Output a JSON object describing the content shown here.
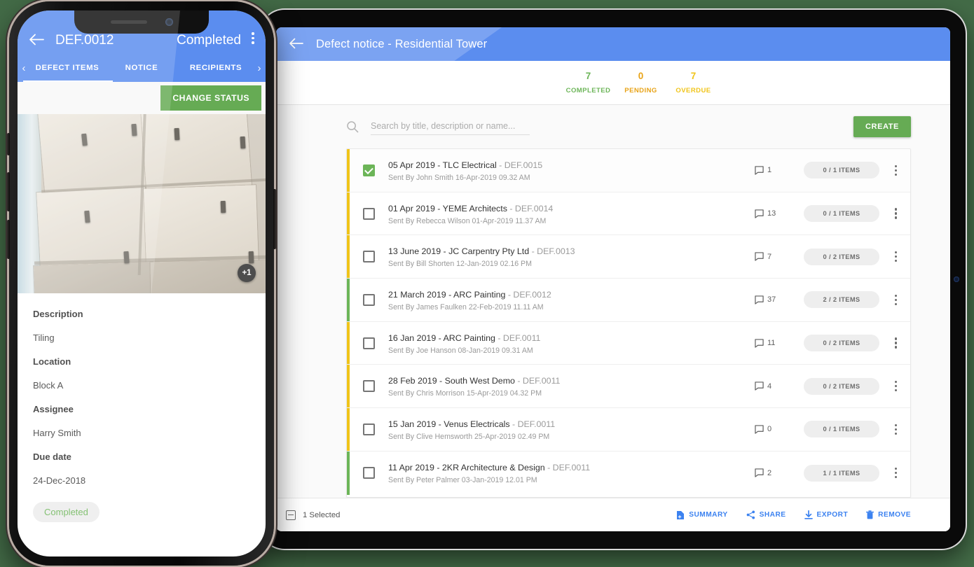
{
  "background_color": "#436b47",
  "tablet": {
    "appbar": {
      "back_icon": "arrow-left-icon",
      "title": "Defect notice - Residential Tower",
      "color": "#5b8def"
    },
    "stats": [
      {
        "num": "7",
        "label": "COMPLETED",
        "color": "#6cb558"
      },
      {
        "num": "0",
        "label": "PENDING",
        "color": "#e8a317"
      },
      {
        "num": "7",
        "label": "OVERDUE",
        "color": "#f0c419"
      }
    ],
    "search": {
      "icon": "search-icon",
      "placeholder": "Search by title, description or name...",
      "value": ""
    },
    "create_button": {
      "label": "CREATE",
      "color": "#66ab54"
    },
    "rows": [
      {
        "title": "05 Apr 2019 - TLC Electrical",
        "ref": " - DEF.0015",
        "sub": "Sent By John Smith 16-Apr-2019 09.32 AM",
        "comments": "1",
        "items": "0 / 1 ITEMS",
        "bar_color": "#f0c419",
        "checked": true
      },
      {
        "title": "01 Apr 2019 - YEME Architects",
        "ref": " - DEF.0014",
        "sub": "Sent By Rebecca Wilson 01-Apr-2019 11.37 AM",
        "comments": "13",
        "items": "0 / 1 ITEMS",
        "bar_color": "#f0c419",
        "checked": false
      },
      {
        "title": "13 June 2019 - JC Carpentry Pty Ltd",
        "ref": " - DEF.0013",
        "sub": "Sent By Bill Shorten 12-Jan-2019 02.16 PM",
        "comments": "7",
        "items": "0 / 2 ITEMS",
        "bar_color": "#f0c419",
        "checked": false
      },
      {
        "title": "21 March 2019 - ARC Painting",
        "ref": " - DEF.0012",
        "sub": "Sent By James Faulken 22-Feb-2019 11.11 AM",
        "comments": "37",
        "items": "2 / 2 ITEMS",
        "bar_color": "#6cb558",
        "checked": false
      },
      {
        "title": "16 Jan 2019 - ARC Painting",
        "ref": " - DEF.0011",
        "sub": "Sent By Joe Hanson 08-Jan-2019 09.31 AM",
        "comments": "11",
        "items": "0 / 2 ITEMS",
        "bar_color": "#f0c419",
        "checked": false
      },
      {
        "title": "28 Feb 2019 - South West Demo",
        "ref": " - DEF.0011",
        "sub": "Sent By Chris Morrison 15-Apr-2019 04.32 PM",
        "comments": "4",
        "items": "0 / 2 ITEMS",
        "bar_color": "#f0c419",
        "checked": false
      },
      {
        "title": "15 Jan 2019 - Venus Electricals",
        "ref": " - DEF.0011",
        "sub": "Sent By Clive Hemsworth 25-Apr-2019 02.49 PM",
        "comments": "0",
        "items": "0 / 1 ITEMS",
        "bar_color": "#f0c419",
        "checked": false
      },
      {
        "title": "11 Apr 2019 - 2KR Architecture & Design",
        "ref": " - DEF.0011",
        "sub": "Sent By Peter Palmer 03-Jan-2019 12.01 PM",
        "comments": "2",
        "items": "1 / 1 ITEMS",
        "bar_color": "#6cb558",
        "checked": false
      }
    ],
    "actionbar": {
      "selected_label": "1 Selected",
      "actions": [
        {
          "label": "SUMMARY",
          "icon": "summary-document-icon"
        },
        {
          "label": "SHARE",
          "icon": "share-icon"
        },
        {
          "label": "EXPORT",
          "icon": "download-icon"
        },
        {
          "label": "REMOVE",
          "icon": "trash-icon"
        }
      ],
      "accent_color": "#3c82f0"
    }
  },
  "phone": {
    "appbar": {
      "back_icon": "arrow-left-icon",
      "defect_id": "DEF.0012",
      "status": "Completed",
      "menu_icon": "kebab-menu-icon"
    },
    "tabs": {
      "prev_icon": "chevron-left-icon",
      "next_icon": "chevron-right-icon",
      "items": [
        {
          "label": "DEFECT ITEMS",
          "active": true
        },
        {
          "label": "NOTICE",
          "active": false
        },
        {
          "label": "RECIPIENTS",
          "active": false
        }
      ]
    },
    "change_status_button": {
      "label": "CHANGE STATUS",
      "color": "#66ab54"
    },
    "photo": {
      "more_badge": "+1"
    },
    "details": [
      {
        "label": "Description",
        "value": "Tiling"
      },
      {
        "label": "Location",
        "value": "Block A"
      },
      {
        "label": "Assignee",
        "value": "Harry Smith"
      },
      {
        "label": "Due date",
        "value": "24-Dec-2018"
      }
    ],
    "status_pill": {
      "label": "Completed",
      "color": "#6cb558"
    }
  }
}
